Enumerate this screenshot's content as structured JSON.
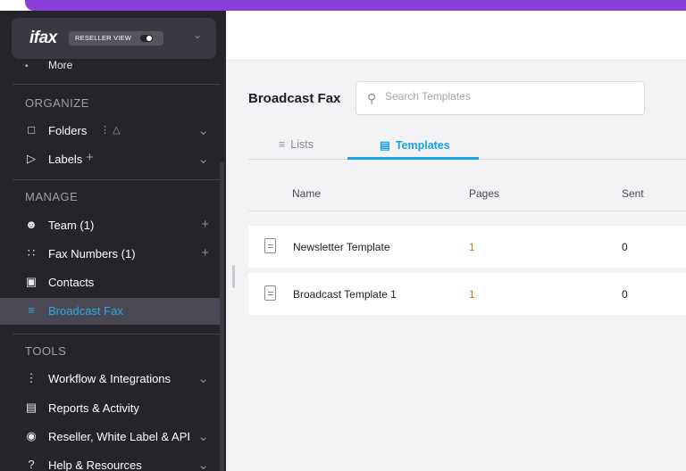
{
  "brand": {
    "logo": "ifax",
    "reseller_label": "RESELLER VIEW"
  },
  "sidebar": {
    "more_label": "More",
    "sections": {
      "organize": "ORGANIZE",
      "manage": "MANAGE",
      "tools": "TOOLS"
    },
    "organize_items": [
      {
        "label": "Folders",
        "icon": "folder-icon"
      },
      {
        "label": "Labels",
        "icon": "label-icon"
      }
    ],
    "manage_items": [
      {
        "label": "Team (1)",
        "icon": "team-icon"
      },
      {
        "label": "Fax Numbers (1)",
        "icon": "dialpad-icon"
      },
      {
        "label": "Contacts",
        "icon": "contacts-icon"
      },
      {
        "label": "Broadcast Fax",
        "icon": "broadcast-icon",
        "active": true
      }
    ],
    "tools_items": [
      {
        "label": "Workflow & Integrations",
        "icon": "workflow-icon"
      },
      {
        "label": "Reports & Activity",
        "icon": "reports-icon"
      },
      {
        "label": "Reseller, White Label & API",
        "icon": "globe-icon"
      },
      {
        "label": "Help & Resources",
        "icon": "help-icon"
      }
    ]
  },
  "main": {
    "title": "Broadcast Fax",
    "search_placeholder": "Search Templates",
    "tabs": [
      {
        "label": "Lists",
        "active": false
      },
      {
        "label": "Templates",
        "active": true
      }
    ],
    "columns": [
      "Name",
      "Pages",
      "Sent"
    ],
    "rows": [
      {
        "name": "Newsletter Template",
        "pages": "1",
        "sent": "0"
      },
      {
        "name": "Broadcast Template 1",
        "pages": "1",
        "sent": "0"
      }
    ]
  },
  "colors": {
    "accent": "#1aa0e6",
    "sidebar_bg": "#26242b",
    "top_strip": "#8b3fd9",
    "pages_value": "#c47b14"
  }
}
